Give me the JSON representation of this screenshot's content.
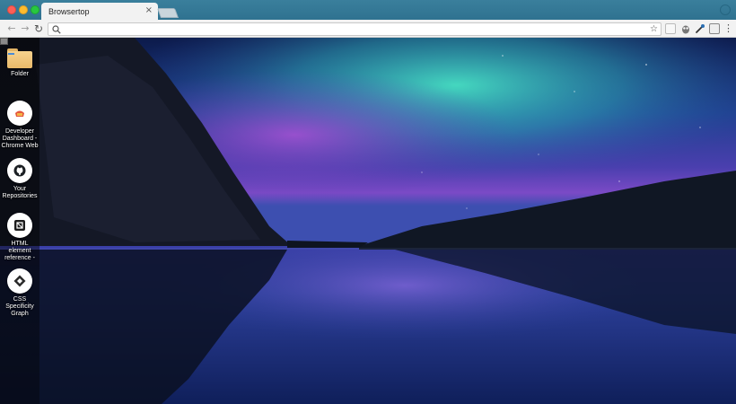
{
  "browser": {
    "tab_title": "Browsertop",
    "tab_close_glyph": "×",
    "omnibox_value": "",
    "omnibox_placeholder": "",
    "icons": {
      "back": "back-arrow-icon",
      "forward": "forward-arrow-icon",
      "reload": "reload-icon",
      "search": "search-icon",
      "bookmark": "star-icon",
      "menu": "vertical-dots-icon",
      "profile": "profile-icon"
    }
  },
  "desktop": {
    "items": [
      {
        "label": "Folder",
        "icon": "folder-icon"
      },
      {
        "label": "Developer Dashboard - Chrome Web",
        "icon": "chrome-web-store-icon"
      },
      {
        "label": "Your Repositories",
        "icon": "github-icon"
      },
      {
        "label": "HTML element reference -",
        "icon": "mdn-icon"
      },
      {
        "label": "CSS Specificity Graph",
        "icon": "css-graph-icon"
      }
    ]
  },
  "colors": {
    "tab_strip": "#2f7290",
    "toolbar": "#f2f2f2",
    "close": "#fc5f57",
    "minimize": "#fdbc2e",
    "maximize": "#28c840",
    "folder": "#f6d28d"
  }
}
